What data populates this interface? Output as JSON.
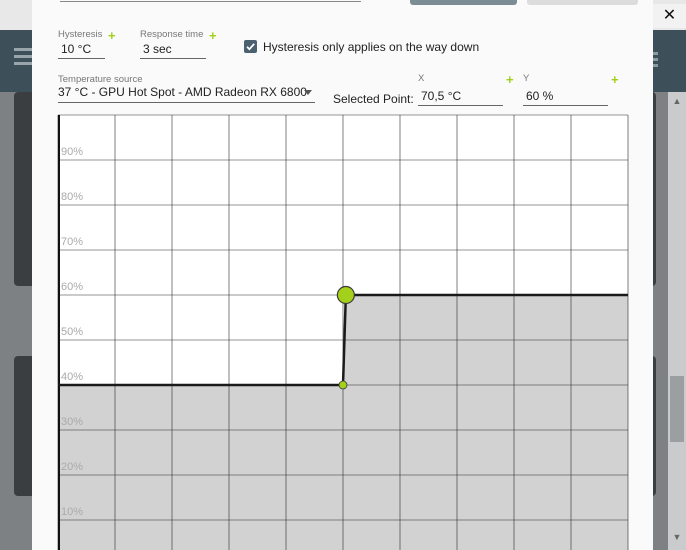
{
  "dialog": {
    "hysteresis": {
      "label": "Hysteresis",
      "value": "10 °C"
    },
    "response_time": {
      "label": "Response time",
      "value": "3 sec"
    },
    "hysteresis_down_checkbox": {
      "label": "Hysteresis only applies on the way down",
      "checked": true
    },
    "temperature_source": {
      "label": "Temperature source",
      "value": "37 °C - GPU Hot Spot - AMD Radeon RX 6800"
    },
    "selected_point": {
      "label": "Selected Point:",
      "x_label": "X",
      "x_value": "70,5 °C",
      "y_label": "Y",
      "y_value": "60 %"
    },
    "close_glyph": "✕",
    "accent_color": "#a3d01a"
  },
  "chart_data": {
    "type": "line",
    "ylim": [
      0,
      100
    ],
    "y_tick_labels": [
      "10%",
      "20%",
      "30%",
      "40%",
      "50%",
      "60%",
      "70%",
      "80%",
      "90%"
    ],
    "grid": true,
    "fan_curve": {
      "x_range_c": [
        20,
        120
      ],
      "points": [
        {
          "x": 20,
          "y": 40
        },
        {
          "x": 70,
          "y": 40
        },
        {
          "x": 70.5,
          "y": 60
        },
        {
          "x": 120,
          "y": 60
        }
      ],
      "selected_index": 2
    }
  }
}
